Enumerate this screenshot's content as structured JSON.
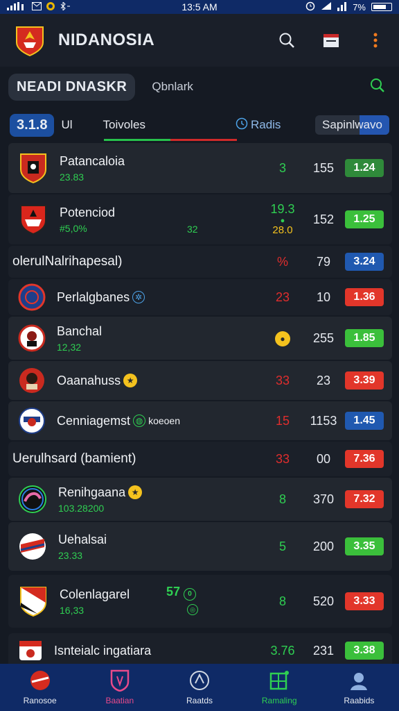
{
  "status_bar": {
    "time": "13:5 AM",
    "battery": "7%"
  },
  "header": {
    "title": "NIDANOSIA"
  },
  "search": {
    "league_label": "NEADI DNASKR",
    "placeholder": "Qbnlark"
  },
  "tabs": {
    "season": "3.1.8",
    "tab_1": "Ul",
    "tab_2": "Toivoles",
    "tab_3": "Radis",
    "tab_4": "Sapinlwavo"
  },
  "rows": [
    {
      "name": "Patancaloia",
      "sub": "23.83",
      "a": "3",
      "b": "155",
      "badge": "1.24"
    },
    {
      "name": "Potenciod",
      "sub": "#5,0%",
      "extra": "32",
      "a_top": "19.3",
      "a_mid": "28.0",
      "b": "152",
      "badge": "1.25"
    },
    {
      "group": "olerulNalrihapesal)",
      "a": "%",
      "b": "79",
      "badge": "3.24"
    },
    {
      "name": "Perlalgbanes",
      "a": "23",
      "b": "10",
      "badge": "1.36"
    },
    {
      "name": "Banchal",
      "sub": "12,32",
      "b": "255",
      "badge": "1.85"
    },
    {
      "name": "Oaanahuss",
      "a": "33",
      "b": "23",
      "badge": "3.39"
    },
    {
      "name": "Cenniagemst",
      "name_suffix": "koeoen",
      "a": "15",
      "b": "1153",
      "badge": "1.45"
    },
    {
      "group": "Uerulhsard (bamient)",
      "a": "33",
      "b": "00",
      "badge": "7.36"
    },
    {
      "name": "Renihgaana",
      "sub": "103.28200",
      "a": "8",
      "b": "370",
      "badge": "7.32"
    },
    {
      "name": "Uehalsai",
      "sub": "23.33",
      "a": "5",
      "b": "200",
      "badge": "3.35"
    },
    {
      "name": "Colenlagarel",
      "sub": "16,33",
      "extra": "57",
      "a": "8",
      "b": "520",
      "badge": "3.33"
    },
    {
      "name": "Isnteialc ingatiara",
      "a": "3.76",
      "b": "231",
      "badge": "3.38"
    }
  ],
  "bottom_nav": [
    {
      "label": "Ranosoe"
    },
    {
      "label": "Baatian"
    },
    {
      "label": "Raatds"
    },
    {
      "label": "Ramaling"
    },
    {
      "label": "Raabids"
    }
  ],
  "colors": {
    "background": "#151a23",
    "bar": "#0f2a66",
    "positive": "#2fcf52",
    "negative": "#e02d2d",
    "accent_blue": "#2059b0"
  }
}
